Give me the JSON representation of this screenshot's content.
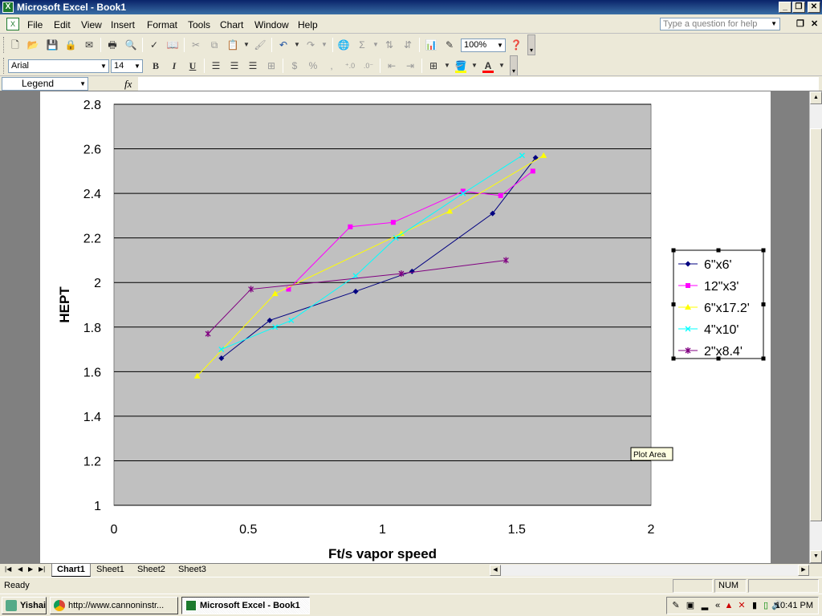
{
  "window": {
    "title": "Microsoft Excel - Book1",
    "minimize_label": "_",
    "restore_label": "❐",
    "close_label": "✕"
  },
  "menu": {
    "items": [
      "File",
      "Edit",
      "View",
      "Insert",
      "Format",
      "Tools",
      "Chart",
      "Window",
      "Help"
    ],
    "help_placeholder": "Type a question for help",
    "doc_restore_label": "❐",
    "doc_close_label": "✕"
  },
  "toolbar": {
    "zoom": "100%",
    "font_name": "Arial",
    "font_size": "14",
    "bold_label": "B",
    "italic_label": "I",
    "underline_label": "U",
    "currency_label": "$",
    "percent_label": "%",
    "comma_label": ",",
    "sum_label": "Σ",
    "font_color": "#ff0000",
    "fill_color": "#ffff00"
  },
  "formula_bar": {
    "name_box": "Legend",
    "fx_label": "fx",
    "content": ""
  },
  "chart_data": {
    "type": "line",
    "title": "",
    "xlabel": "Ft/s vapor speed",
    "ylabel": "HEPT",
    "xlim": [
      0,
      2
    ],
    "ylim": [
      1,
      2.8
    ],
    "x_ticks": [
      "0",
      "0.5",
      "1",
      "1.5",
      "2"
    ],
    "y_ticks": [
      "1",
      "1.2",
      "1.4",
      "1.6",
      "1.8",
      "2",
      "2.2",
      "2.4",
      "2.6",
      "2.8"
    ],
    "plot_area_color": "#c0c0c0",
    "grid": true,
    "legend_position": "right",
    "tooltip": "Plot Area",
    "series": [
      {
        "name": "6\"x6'",
        "color": "#000080",
        "marker": "diamond",
        "points": [
          [
            0.4,
            1.66
          ],
          [
            0.58,
            1.83
          ],
          [
            0.9,
            1.96
          ],
          [
            1.11,
            2.05
          ],
          [
            1.41,
            2.31
          ],
          [
            1.57,
            2.56
          ]
        ]
      },
      {
        "name": "12\"x3'",
        "color": "#ff00ff",
        "marker": "square",
        "points": [
          [
            0.65,
            1.97
          ],
          [
            0.88,
            2.25
          ],
          [
            1.04,
            2.27
          ],
          [
            1.3,
            2.41
          ],
          [
            1.44,
            2.39
          ],
          [
            1.56,
            2.5
          ]
        ]
      },
      {
        "name": "6\"x17.2'",
        "color": "#ffff00",
        "marker": "triangle",
        "points": [
          [
            0.31,
            1.58
          ],
          [
            0.6,
            1.95
          ],
          [
            1.07,
            2.22
          ],
          [
            1.25,
            2.32
          ],
          [
            1.6,
            2.57
          ]
        ]
      },
      {
        "name": "4\"x10'",
        "color": "#00ffff",
        "marker": "x",
        "points": [
          [
            0.4,
            1.7
          ],
          [
            0.6,
            1.8
          ],
          [
            0.66,
            1.83
          ],
          [
            0.9,
            2.03
          ],
          [
            1.05,
            2.2
          ],
          [
            1.3,
            2.4
          ],
          [
            1.52,
            2.57
          ]
        ]
      },
      {
        "name": "2\"x8.4'",
        "color": "#800080",
        "marker": "star",
        "points": [
          [
            0.35,
            1.77
          ],
          [
            0.51,
            1.97
          ],
          [
            1.07,
            2.04
          ],
          [
            1.46,
            2.1
          ]
        ]
      }
    ]
  },
  "sheet_tabs": [
    "Chart1",
    "Sheet1",
    "Sheet2",
    "Sheet3"
  ],
  "active_tab": "Chart1",
  "status": {
    "ready": "Ready",
    "num": "NUM"
  },
  "taskbar": {
    "items": [
      {
        "label": "Yishai"
      },
      {
        "label": "http://www.cannoninstr..."
      },
      {
        "label": "Microsoft Excel - Book1"
      }
    ],
    "clock": "10:41 PM"
  }
}
